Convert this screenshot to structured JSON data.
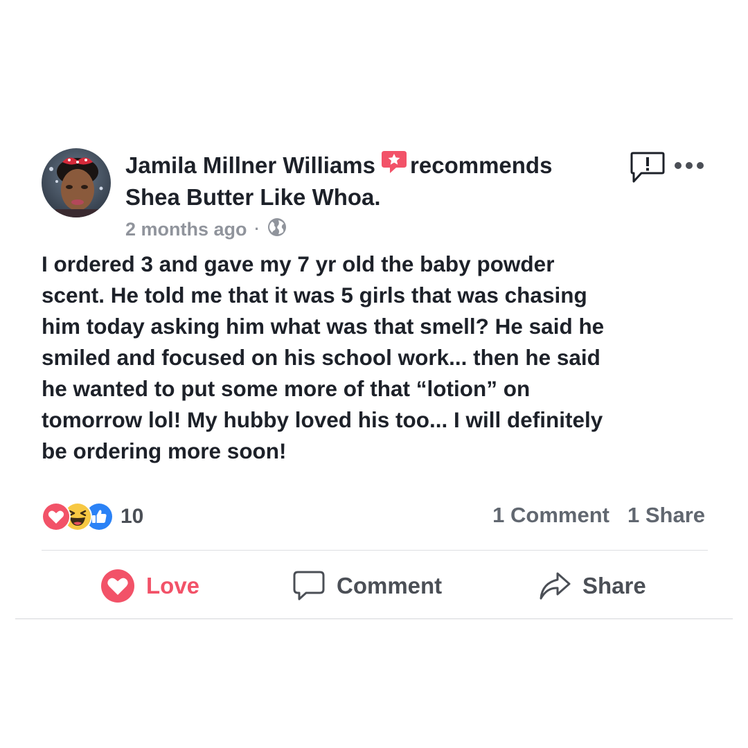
{
  "post": {
    "author": "Jamila Millner Williams",
    "action_word": "recommends",
    "page_name": "Shea Butter Like Whoa.",
    "timestamp": "2 months ago",
    "separator": "·",
    "privacy_icon": "globe-icon",
    "body": "I ordered 3 and gave my 7 yr old the baby powder\nscent. He told me that it was 5 girls that was chasing\nhim today asking him what was that smell? He said he\nsmiled and focused on his school work... then he said\nhe wanted to put some more of that “lotion” on\ntomorrow lol! My hubby loved his too... I will definitely\nbe ordering more soon!"
  },
  "reactions": {
    "types": [
      "love-reaction-icon",
      "haha-reaction-icon",
      "like-reaction-icon"
    ],
    "count": "10"
  },
  "counts": {
    "comments": "1 Comment",
    "shares": "1 Share"
  },
  "actions": {
    "love_label": "Love",
    "comment_label": "Comment",
    "share_label": "Share"
  },
  "icons": {
    "recommend_badge": "recommend-star-icon",
    "report": "report-icon",
    "more": "more-options-icon"
  },
  "colors": {
    "love_red": "#f25268",
    "like_blue": "#2b82f6",
    "haha_yellow": "#f7c843",
    "meta_gray": "#90949c",
    "text": "#1d2129"
  }
}
